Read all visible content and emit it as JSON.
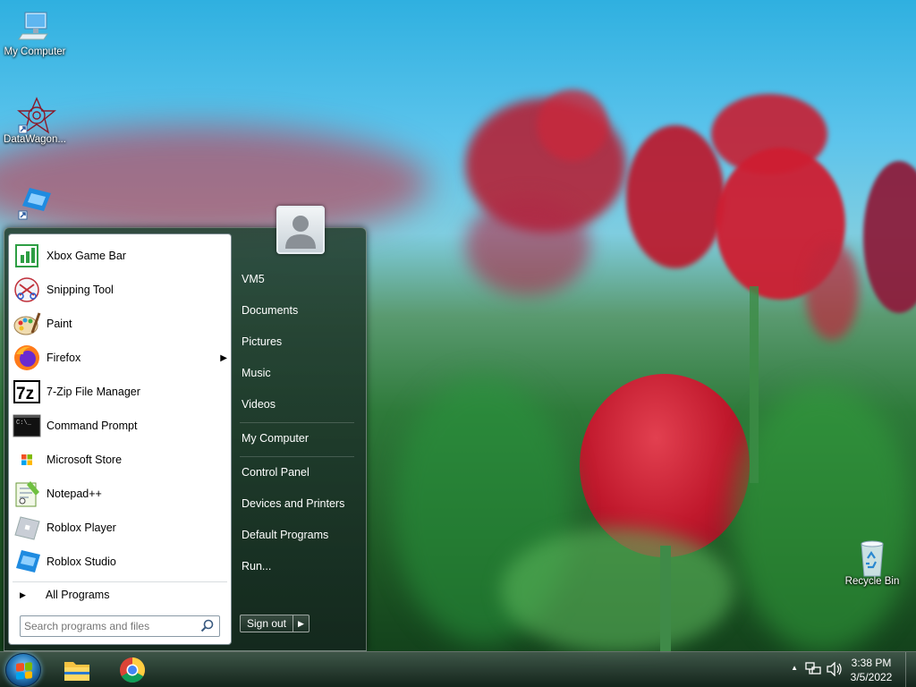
{
  "desktop": {
    "icons": [
      {
        "label": "My Computer",
        "icon": "monitor-icon"
      },
      {
        "label": "DataWagon...",
        "icon": "datawagon-icon"
      },
      {
        "label": "",
        "icon": "roblox-studio-shortcut-icon"
      },
      {
        "label": "Recycle Bin",
        "icon": "recycle-bin-icon"
      }
    ]
  },
  "start_menu": {
    "programs": [
      {
        "label": "Xbox Game Bar",
        "icon": "xbox-game-bar-icon"
      },
      {
        "label": "Snipping Tool",
        "icon": "snipping-tool-icon"
      },
      {
        "label": "Paint",
        "icon": "paint-icon"
      },
      {
        "label": "Firefox",
        "icon": "firefox-icon",
        "has_submenu": true
      },
      {
        "label": "7-Zip File Manager",
        "icon": "7zip-icon"
      },
      {
        "label": "Command Prompt",
        "icon": "command-prompt-icon"
      },
      {
        "label": "Microsoft Store",
        "icon": "microsoft-store-icon"
      },
      {
        "label": "Notepad++",
        "icon": "notepadpp-icon"
      },
      {
        "label": "Roblox Player",
        "icon": "roblox-player-icon"
      },
      {
        "label": "Roblox Studio",
        "icon": "roblox-studio-icon"
      }
    ],
    "all_programs": "All Programs",
    "search_placeholder": "Search programs and files",
    "right_items": [
      {
        "label": "VM5"
      },
      {
        "label": "Documents"
      },
      {
        "label": "Pictures"
      },
      {
        "label": "Music"
      },
      {
        "label": "Videos"
      },
      {
        "label": "My Computer"
      },
      {
        "label": "Control Panel"
      },
      {
        "label": "Devices and Printers"
      },
      {
        "label": "Default Programs"
      },
      {
        "label": "Run..."
      }
    ],
    "sign_out": "Sign out",
    "sign_out_arrow": "▶"
  },
  "taskbar": {
    "pinned": [
      {
        "icon": "file-explorer-icon"
      },
      {
        "icon": "chrome-icon"
      }
    ],
    "tray": {
      "show_hidden": "▲",
      "time": "3:38 PM",
      "date": "3/5/2022"
    }
  },
  "colors": {
    "sky": "#4fbde8",
    "tulip": "#c8202f",
    "grass": "#2e7a3a",
    "menu_dark": "#1f3b2e"
  }
}
